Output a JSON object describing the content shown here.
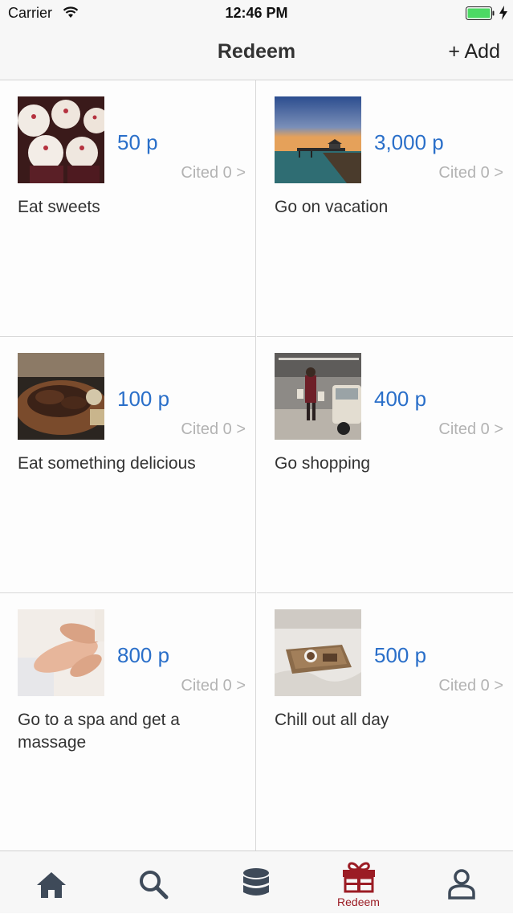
{
  "status_bar": {
    "carrier": "Carrier",
    "time": "12:46 PM",
    "icons": [
      "wifi-icon",
      "battery-icon",
      "charging-bolt-icon"
    ]
  },
  "nav": {
    "title": "Redeem",
    "add_label": "+ Add"
  },
  "rewards": [
    {
      "points": "50 p",
      "cited": "Cited 0 >",
      "title": "Eat sweets",
      "image": "cupcakes-photo"
    },
    {
      "points": "3,000 p",
      "cited": "Cited 0 >",
      "title": "Go on vacation",
      "image": "pier-sunset-photo"
    },
    {
      "points": "100 p",
      "cited": "Cited 0 >",
      "title": "Eat something delicious",
      "image": "steak-dinner-photo"
    },
    {
      "points": "400 p",
      "cited": "Cited 0 >",
      "title": "Go shopping",
      "image": "shopping-parking-photo"
    },
    {
      "points": "800 p",
      "cited": "Cited 0 >",
      "title": "Go to a spa and get a massage",
      "image": "foot-massage-photo"
    },
    {
      "points": "500 p",
      "cited": "Cited 0 >",
      "title": "Chill out all day",
      "image": "coffee-tray-bed-photo"
    }
  ],
  "tabs": [
    {
      "icon": "home-icon",
      "label": ""
    },
    {
      "icon": "search-icon",
      "label": ""
    },
    {
      "icon": "database-icon",
      "label": ""
    },
    {
      "icon": "gift-icon",
      "label": "Redeem",
      "active": true
    },
    {
      "icon": "person-icon",
      "label": ""
    }
  ],
  "colors": {
    "accent": "#9b1c24",
    "points": "#2a6fc9",
    "inactive_icon": "#3e4a59",
    "muted_text": "#b3b3b3"
  }
}
